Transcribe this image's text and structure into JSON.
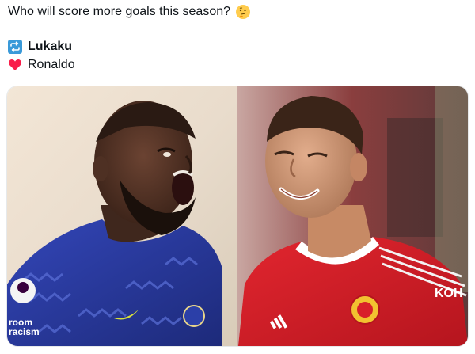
{
  "tweet": {
    "text": "Who will score more goals this season?",
    "emoji": "thinking-face-icon",
    "options": [
      {
        "icon": "repeat-icon",
        "label": "Lukaku"
      },
      {
        "icon": "heart-icon",
        "label": "Ronaldo"
      }
    ]
  },
  "media": {
    "description_icons": [
      "premier-league-badge-icon",
      "chelsea-crest-icon",
      "nike-swoosh-icon",
      "manchester-united-crest-icon",
      "adidas-logo-icon"
    ],
    "shirt_sponsor_left": "room racism",
    "shirt_sponsor_right": "KOH",
    "colors": {
      "left_shirt": "#2b3fa8",
      "right_shirt": "#d8202a",
      "heart": "#f91e4a",
      "repeat_box": "#3a9ad9"
    }
  }
}
